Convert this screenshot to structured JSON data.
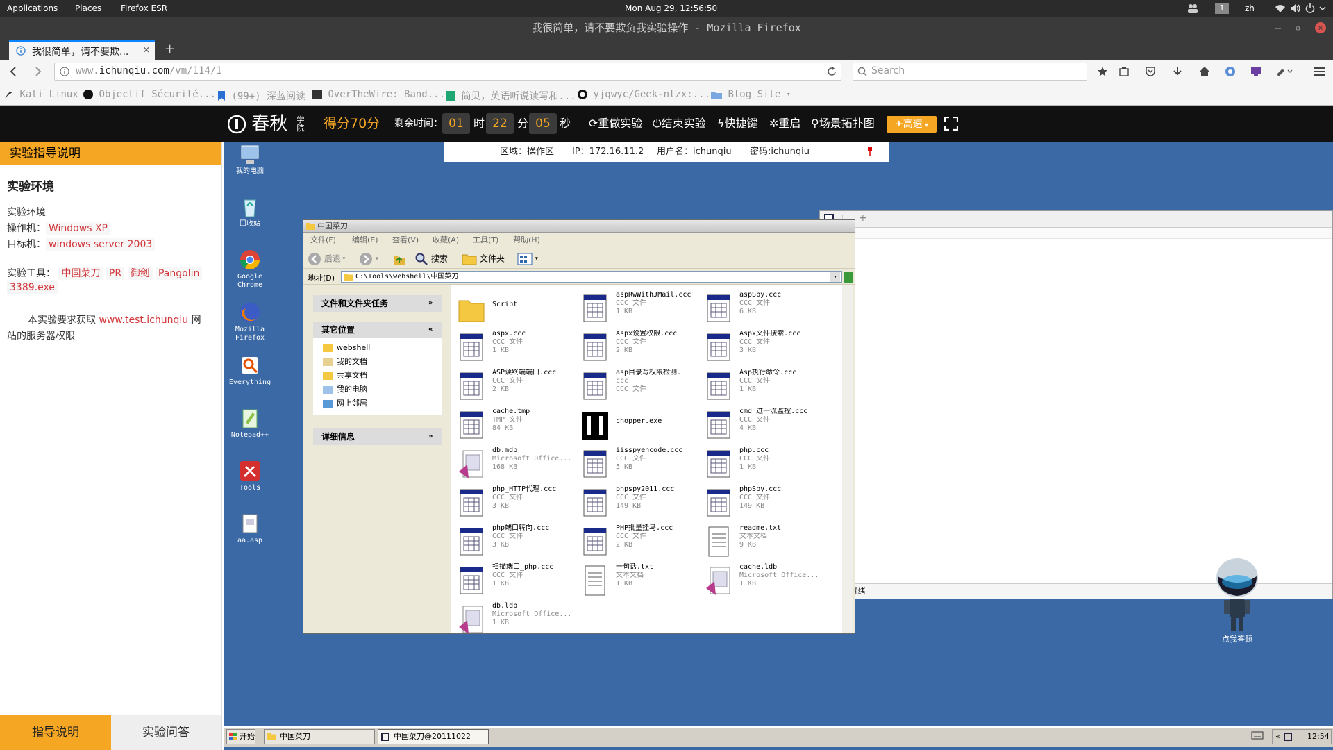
{
  "gnome": {
    "applications": "Applications",
    "places": "Places",
    "firefox_esr": "Firefox ESR",
    "clock": "Mon Aug 29, 12:56:50",
    "workspace": "1",
    "lang": "zh"
  },
  "window_title": "我很简单，请不要欺负我实验操作 - Mozilla Firefox",
  "tab": {
    "label": "我很简单，请不要欺..."
  },
  "url": {
    "prefix": "www.",
    "domain": "ichunqiu.com",
    "path": "/vm/114/1"
  },
  "search": {
    "placeholder": "Search"
  },
  "bookmarks": [
    "Kali Linux",
    "Objectif Sécurité...",
    "(99+) 深蓝阅读",
    "OverTheWire: Band...",
    "简贝，英语听说读写和...",
    "yjqwyc/Geek-ntzx:...",
    "Blog Site"
  ],
  "header": {
    "logo_text": "春秋",
    "logo_sub1": "学",
    "logo_sub2": "院",
    "score": "得分70分",
    "remaining_label": "剩余时间：",
    "hours": "01",
    "hours_unit": "时",
    "minutes": "22",
    "minutes_unit": "分",
    "seconds": "05",
    "seconds_unit": "秒",
    "redo": "重做实验",
    "end": "结束实验",
    "shortcut": "快捷键",
    "restart": "重启",
    "topology": "场景拓扑图",
    "speed": "高速"
  },
  "guide": {
    "title": "实验指导说明",
    "env_heading": "实验环境",
    "env_label": "实验环境",
    "operator_label": "操作机：",
    "operator_value": "Windows XP",
    "target_label": "目标机：",
    "target_value": "windows server 2003",
    "tools_label": "实验工具：",
    "tools": [
      "中国菜刀",
      "PR",
      "御剑",
      "Pangolin",
      "3389.exe"
    ],
    "task_prefix": "本实验要求获取",
    "task_link": "www.test.ichunqiu",
    "task_suffix": "网站的服务器权限",
    "tab_guide": "指导说明",
    "tab_qa": "实验问答"
  },
  "vm_info": {
    "zone": "区域：操作区",
    "ip": "IP：172.16.11.2",
    "username": "用户名：ichunqiu",
    "password": "密码:ichunqiu"
  },
  "desktop_icons": [
    {
      "label1": "我的电脑",
      "label2": ""
    },
    {
      "label1": "回收站",
      "label2": ""
    },
    {
      "label1": "Google",
      "label2": "Chrome"
    },
    {
      "label1": "Mozilla",
      "label2": "Firefox"
    },
    {
      "label1": "Everything",
      "label2": ""
    },
    {
      "label1": "Notepad++",
      "label2": ""
    },
    {
      "label1": "Tools",
      "label2": ""
    },
    {
      "label1": "aa.asp",
      "label2": ""
    }
  ],
  "explorer": {
    "title": "中国菜刀",
    "menu": [
      "文件(F)",
      "编辑(E)",
      "查看(V)",
      "收藏(A)",
      "工具(T)",
      "帮助(H)"
    ],
    "back": "后退",
    "search": "搜索",
    "folders": "文件夹",
    "address_label": "地址(D)",
    "address": "C:\\Tools\\webshell\\中国菜刀",
    "tasks_header": "文件和文件夹任务",
    "other_header": "其它位置",
    "other_places": [
      "webshell",
      "我的文档",
      "共享文档",
      "我的电脑",
      "网上邻居"
    ],
    "details_header": "详细信息",
    "files": [
      {
        "name": "Script",
        "type": "",
        "size": "",
        "icon": "folder"
      },
      {
        "name": "aspRwWithJMail.ccc",
        "type": "CCC 文件",
        "size": "1 KB",
        "icon": "doc"
      },
      {
        "name": "aspSpy.ccc",
        "type": "CCC 文件",
        "size": "6 KB",
        "icon": "doc"
      },
      {
        "name": "aspx.ccc",
        "type": "CCC 文件",
        "size": "1 KB",
        "icon": "doc"
      },
      {
        "name": "Aspx设置权限.ccc",
        "type": "CCC 文件",
        "size": "2 KB",
        "icon": "doc"
      },
      {
        "name": "Aspx文件搜索.ccc",
        "type": "CCC 文件",
        "size": "3 KB",
        "icon": "doc"
      },
      {
        "name": "ASP读终端端口.ccc",
        "type": "CCC 文件",
        "size": "2 KB",
        "icon": "doc"
      },
      {
        "name": "asp目录写权限检测.",
        "type": "ccc",
        "size": "CCC 文件",
        "icon": "doc"
      },
      {
        "name": "Asp执行命令.ccc",
        "type": "CCC 文件",
        "size": "1 KB",
        "icon": "doc"
      },
      {
        "name": "cache.tmp",
        "type": "TMP 文件",
        "size": "84 KB",
        "icon": "doc"
      },
      {
        "name": "chopper.exe",
        "type": "",
        "size": "",
        "icon": "exe"
      },
      {
        "name": "cmd_过一流监控.ccc",
        "type": "CCC 文件",
        "size": "4 KB",
        "icon": "doc"
      },
      {
        "name": "db.mdb",
        "type": "Microsoft Office...",
        "size": "168 KB",
        "icon": "mdb"
      },
      {
        "name": "iisspyencode.ccc",
        "type": "CCC 文件",
        "size": "5 KB",
        "icon": "doc"
      },
      {
        "name": "php.ccc",
        "type": "CCC 文件",
        "size": "1 KB",
        "icon": "doc"
      },
      {
        "name": "php_HTTP代理.ccc",
        "type": "CCC 文件",
        "size": "3 KB",
        "icon": "doc"
      },
      {
        "name": "phpspy2011.ccc",
        "type": "CCC 文件",
        "size": "149 KB",
        "icon": "doc"
      },
      {
        "name": "phpSpy.ccc",
        "type": "CCC 文件",
        "size": "149 KB",
        "icon": "doc"
      },
      {
        "name": "php端口转向.ccc",
        "type": "CCC 文件",
        "size": "3 KB",
        "icon": "doc"
      },
      {
        "name": "PHP批量挂马.ccc",
        "type": "CCC 文件",
        "size": "2 KB",
        "icon": "doc"
      },
      {
        "name": "readme.txt",
        "type": "文本文档",
        "size": "9 KB",
        "icon": "txt"
      },
      {
        "name": "扫描端口_php.ccc",
        "type": "CCC 文件",
        "size": "1 KB",
        "icon": "doc"
      },
      {
        "name": "一句话.txt",
        "type": "文本文档",
        "size": "1 KB",
        "icon": "txt"
      },
      {
        "name": "cache.ldb",
        "type": "Microsoft Office...",
        "size": "1 KB",
        "icon": "ldb"
      },
      {
        "name": "db.ldb",
        "type": "Microsoft Office...",
        "size": "1 KB",
        "icon": "ldb"
      }
    ]
  },
  "chopper": {
    "status": "准备就绪"
  },
  "assistant": {
    "label": "点我答题"
  },
  "taskbar": {
    "start": "开始",
    "task1": "中国菜刀",
    "task2": "中国菜刀@20111022",
    "time": "12:54"
  }
}
